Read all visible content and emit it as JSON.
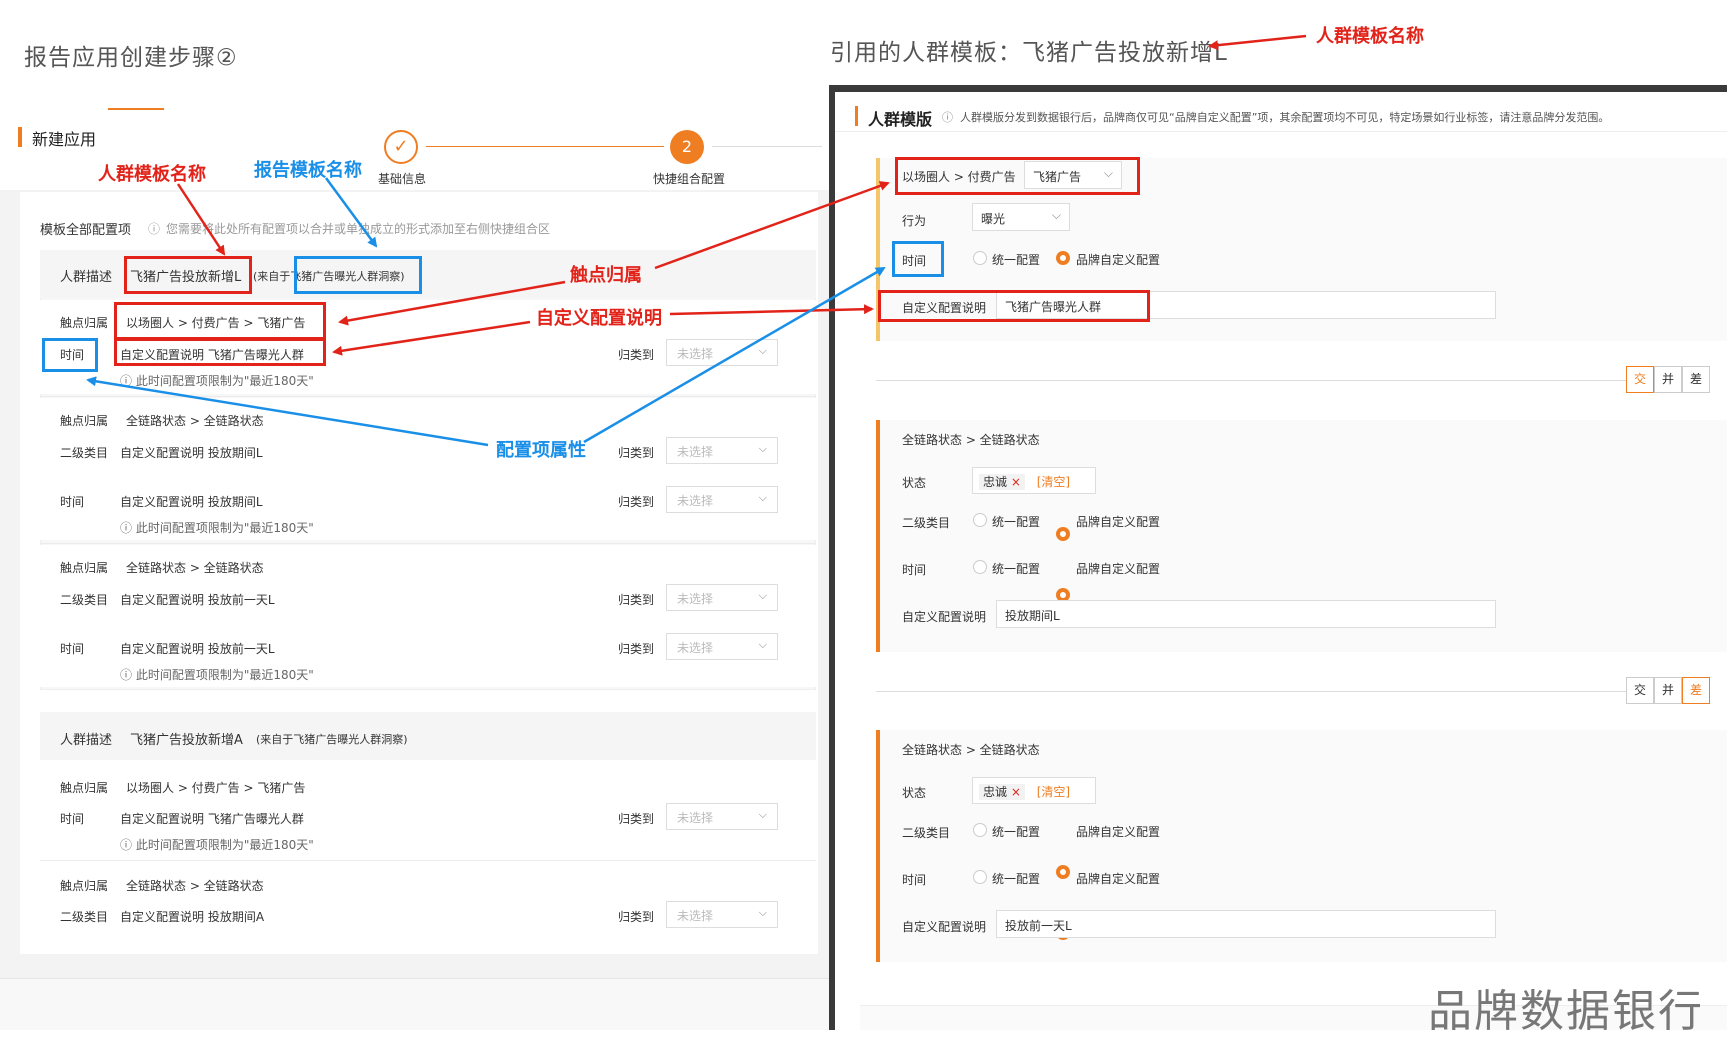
{
  "titles": {
    "left": "报告应用创建步骤②",
    "right": "引用的人群模板：飞猪广告投放新增L"
  },
  "annotations": {
    "crowd_template_name": "人群模板名称",
    "report_template_name": "报告模板名称",
    "touchpoint": "触点归属",
    "custom_desc": "自定义配置说明",
    "config_attr": "配置项属性",
    "crowd_template_name_right": "人群模板名称"
  },
  "left": {
    "header": "新建应用",
    "steps": [
      {
        "label": "基础信息",
        "icon": "✓"
      },
      {
        "label": "快捷组合配置",
        "icon": "2"
      }
    ],
    "all_config_label": "模板全部配置项",
    "all_config_hint": "您需要将此处所有配置项以合并或单独成立的形式添加至右侧快捷组合区",
    "group1": {
      "desc_label": "人群描述",
      "name": "飞猪广告投放新增L",
      "source": "(来自于飞猪广告曝光人群洞察)",
      "blocks": [
        {
          "rows": [
            {
              "label": "触点归属",
              "value": "以场圈人 > 付费广告 > 飞猪广告"
            },
            {
              "label": "时间",
              "value": "自定义配置说明    飞猪广告曝光人群",
              "classify": "归类到",
              "select": "未选择"
            }
          ],
          "note": "此时间配置项限制为\"最近180天\""
        },
        {
          "rows": [
            {
              "label": "触点归属",
              "value": "全链路状态 > 全链路状态"
            },
            {
              "label": "二级类目",
              "value": "自定义配置说明    投放期间L",
              "classify": "归类到",
              "select": "未选择"
            },
            {
              "label": "时间",
              "value": "自定义配置说明    投放期间L",
              "classify": "归类到",
              "select": "未选择"
            }
          ],
          "note": "此时间配置项限制为\"最近180天\""
        },
        {
          "rows": [
            {
              "label": "触点归属",
              "value": "全链路状态 > 全链路状态"
            },
            {
              "label": "二级类目",
              "value": "自定义配置说明    投放前一天L",
              "classify": "归类到",
              "select": "未选择"
            },
            {
              "label": "时间",
              "value": "自定义配置说明    投放前一天L",
              "classify": "归类到",
              "select": "未选择"
            }
          ],
          "note": "此时间配置项限制为\"最近180天\""
        }
      ]
    },
    "group2": {
      "desc_label": "人群描述",
      "name": "飞猪广告投放新增A",
      "source": "(来自于飞猪广告曝光人群洞察)",
      "rows": [
        {
          "label": "触点归属",
          "value": "以场圈人 > 付费广告 > 飞猪广告"
        },
        {
          "label": "时间",
          "value": "自定义配置说明    飞猪广告曝光人群",
          "classify": "归类到",
          "select": "未选择"
        },
        {
          "label": "触点归属",
          "value": "全链路状态 > 全链路状态"
        },
        {
          "label": "二级类目",
          "value": "自定义配置说明    投放期间A",
          "classify": "归类到",
          "select": "未选择"
        }
      ],
      "note": "此时间配置项限制为\"最近180天\""
    }
  },
  "right": {
    "header": "人群模版",
    "hint": "人群模版分发到数据银行后，品牌商仅可见“品牌自定义配置”项，其余配置项均不可见，特定场景如行业标签，请注意品牌分发范围。",
    "card1": {
      "path": "以场圈人 > 付费广告",
      "path_select": "飞猪广告",
      "behavior_label": "行为",
      "behavior_value": "曝光",
      "time_label": "时间",
      "opt_unified": "统一配置",
      "opt_brand": "品牌自定义配置",
      "custom_label": "自定义配置说明",
      "custom_value": "飞猪广告曝光人群"
    },
    "ops1": [
      "交",
      "并",
      "差"
    ],
    "card2": {
      "path": "全链路状态 > 全链路状态",
      "state_label": "状态",
      "state_tag": "忠诚",
      "clear": "[清空]",
      "cat_label": "二级类目",
      "time_label": "时间",
      "opt_unified": "统一配置",
      "opt_brand": "品牌自定义配置",
      "custom_label": "自定义配置说明",
      "custom_value": "投放期间L"
    },
    "ops2": [
      "交",
      "并",
      "差"
    ],
    "card3": {
      "path": "全链路状态 > 全链路状态",
      "state_label": "状态",
      "state_tag": "忠诚",
      "clear": "[清空]",
      "cat_label": "二级类目",
      "time_label": "时间",
      "opt_unified": "统一配置",
      "opt_brand": "品牌自定义配置",
      "custom_label": "自定义配置说明",
      "custom_value": "投放前一天L"
    }
  },
  "watermark": "品牌数据银行",
  "colors": {
    "accent": "#ef7d22",
    "red": "#e2231a",
    "blue": "#1a8fe8"
  }
}
